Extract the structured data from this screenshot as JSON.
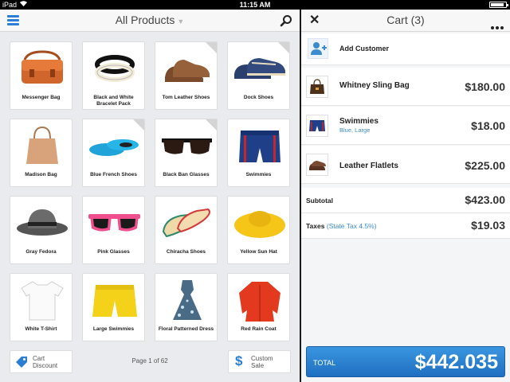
{
  "status_bar": {
    "carrier": "iPad",
    "time": "11:15 AM",
    "battery_level": 0.9
  },
  "products_header": {
    "title": "All Products"
  },
  "products": [
    {
      "name": "Messenger Bag",
      "badge": false
    },
    {
      "name": "Black and White Bracelet Pack",
      "badge": false
    },
    {
      "name": "Tom Leather Shoes",
      "badge": true
    },
    {
      "name": "Dock Shoes",
      "badge": true
    },
    {
      "name": "Madison Bag",
      "badge": false
    },
    {
      "name": "Blue French Shoes",
      "badge": true
    },
    {
      "name": "Black Ban Glasses",
      "badge": true
    },
    {
      "name": "Swimmies",
      "badge": false
    },
    {
      "name": "Gray Fedora",
      "badge": false
    },
    {
      "name": "Pink Glasses",
      "badge": false
    },
    {
      "name": "Chiracha Shoes",
      "badge": false
    },
    {
      "name": "Yellow Sun Hat",
      "badge": false
    },
    {
      "name": "White T-Shirt",
      "badge": false
    },
    {
      "name": "Large Swimmies",
      "badge": false
    },
    {
      "name": "Floral Patterned Dress",
      "badge": false
    },
    {
      "name": "Red Rain Coat",
      "badge": false
    }
  ],
  "footer": {
    "cart_discount": [
      "Cart",
      "Discount"
    ],
    "page_indicator": "Page 1 of 62",
    "custom_sale": [
      "Custom",
      "Sale"
    ]
  },
  "cart_header": {
    "title": "Cart (3)"
  },
  "cart": {
    "add_customer": "Add Customer",
    "items": [
      {
        "name": "Whitney Sling Bag",
        "variant": "",
        "price": "$180.00"
      },
      {
        "name": "Swimmies",
        "variant": "Blue, Large",
        "price": "$18.00"
      },
      {
        "name": "Leather Flatlets",
        "variant": "",
        "price": "$225.00"
      }
    ],
    "subtotal_label": "Subtotal",
    "subtotal_value": "$423.00",
    "taxes_label": "Taxes",
    "taxes_note": "(State Tax 4.5%)",
    "taxes_value": "$19.03",
    "total_label": "TOTAL",
    "total_value": "$442.035"
  },
  "colors": {
    "accent": "#2a7ed3",
    "total_bar": "#2a86d6",
    "link": "#3a8ccf"
  },
  "icons": [
    "menu-icon",
    "search-icon",
    "close-icon",
    "more-icon",
    "add-person-icon",
    "tag-icon",
    "dollar-icon"
  ]
}
